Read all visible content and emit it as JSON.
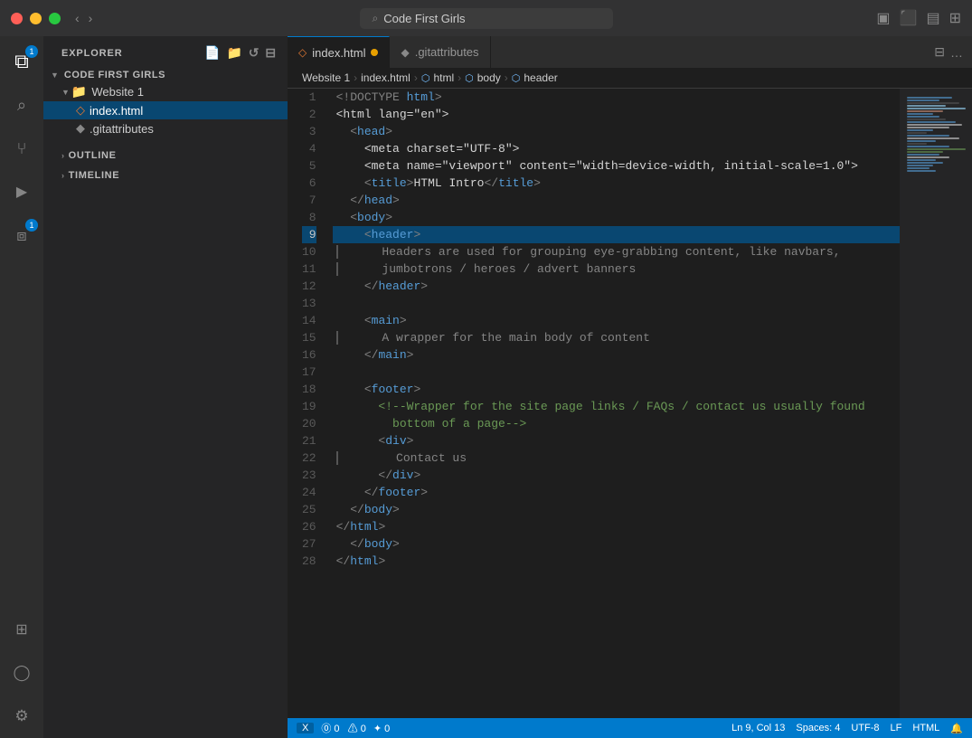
{
  "titlebar": {
    "search_placeholder": "Code First Girls",
    "nav_back": "‹",
    "nav_fwd": "›"
  },
  "activity_bar": {
    "icons": [
      {
        "name": "explorer-icon",
        "symbol": "⧉",
        "active": true,
        "badge": "1"
      },
      {
        "name": "search-icon",
        "symbol": "🔍",
        "active": false
      },
      {
        "name": "source-control-icon",
        "symbol": "⑂",
        "active": false
      },
      {
        "name": "run-debug-icon",
        "symbol": "▷",
        "active": false
      },
      {
        "name": "extensions-icon",
        "symbol": "⧈",
        "active": false,
        "badge": "1"
      }
    ],
    "bottom_icons": [
      {
        "name": "remote-explorer-icon",
        "symbol": "⊞"
      },
      {
        "name": "account-icon",
        "symbol": "👤"
      },
      {
        "name": "settings-icon",
        "symbol": "⚙"
      }
    ]
  },
  "sidebar": {
    "header": "EXPLORER",
    "actions": [
      "📄+",
      "📁+",
      "↺",
      "⊟"
    ],
    "workspace": "CODE FIRST GIRLS",
    "folders": [
      {
        "name": "Website 1",
        "expanded": true,
        "files": [
          {
            "name": "index.html",
            "active": true,
            "icon": "◇",
            "color": "#e37933"
          },
          {
            "name": ".gitattributes",
            "icon": "◆",
            "color": "#888"
          }
        ]
      }
    ],
    "outline_label": "OUTLINE",
    "timeline_label": "TIMELINE"
  },
  "tabs": [
    {
      "label": "index.html",
      "icon": "◇",
      "active": true,
      "modified": true
    },
    {
      "label": ".gitattributes",
      "icon": "◆",
      "active": false,
      "modified": false
    }
  ],
  "breadcrumb": {
    "items": [
      "Website 1",
      "index.html",
      "html",
      "body",
      "header"
    ]
  },
  "code": {
    "lines": [
      {
        "num": 1,
        "content": "<!DOCTYPE html>",
        "type": "doctype"
      },
      {
        "num": 2,
        "content": "<html lang=\"en\">",
        "type": "tag"
      },
      {
        "num": 3,
        "content": "  <head>",
        "type": "tag"
      },
      {
        "num": 4,
        "content": "    <meta charset=\"UTF-8\">",
        "type": "tag"
      },
      {
        "num": 5,
        "content": "    <meta name=\"viewport\" content=\"width=device-width, initial-scale=1.0\">",
        "type": "tag"
      },
      {
        "num": 6,
        "content": "    <title>HTML Intro</title>",
        "type": "tag"
      },
      {
        "num": 7,
        "content": "  </head>",
        "type": "tag"
      },
      {
        "num": 8,
        "content": "  <body>",
        "type": "tag"
      },
      {
        "num": 9,
        "content": "    <header>",
        "type": "tag",
        "highlighted": true
      },
      {
        "num": 10,
        "content": "      Headers are used for grouping eye-grabbing content, like navbars,",
        "type": "text"
      },
      {
        "num": 11,
        "content": "      jumbotrons / heroes / advert banners",
        "type": "text"
      },
      {
        "num": 12,
        "content": "    </header>",
        "type": "tag"
      },
      {
        "num": 13,
        "content": "",
        "type": "empty"
      },
      {
        "num": 14,
        "content": "    <main>",
        "type": "tag"
      },
      {
        "num": 15,
        "content": "      A wrapper for the main body of content",
        "type": "text"
      },
      {
        "num": 16,
        "content": "    </main>",
        "type": "tag"
      },
      {
        "num": 17,
        "content": "",
        "type": "empty"
      },
      {
        "num": 18,
        "content": "    <footer>",
        "type": "tag"
      },
      {
        "num": 19,
        "content": "      <!--Wrapper for the site page links / FAQs / contact us usually found",
        "type": "comment"
      },
      {
        "num": 20,
        "content": "        bottom of a page-->",
        "type": "comment"
      },
      {
        "num": 21,
        "content": "      <div>",
        "type": "tag"
      },
      {
        "num": 22,
        "content": "        Contact us",
        "type": "text"
      },
      {
        "num": 23,
        "content": "      </div>",
        "type": "tag"
      },
      {
        "num": 24,
        "content": "    </footer>",
        "type": "tag"
      },
      {
        "num": 25,
        "content": "  </body>",
        "type": "tag"
      },
      {
        "num": 26,
        "content": "</html>",
        "type": "tag"
      },
      {
        "num": 27,
        "content": "  </body>",
        "type": "tag"
      },
      {
        "num": 28,
        "content": "</html>",
        "type": "tag"
      }
    ]
  },
  "status_bar": {
    "branch": "X",
    "errors": "⓪ 0  ⚠ 0",
    "notifications": "✦ 0",
    "position": "Ln 9, Col 13",
    "spaces": "Spaces: 4",
    "encoding": "UTF-8",
    "line_ending": "LF",
    "language": "HTML",
    "feedback": "🔔"
  }
}
